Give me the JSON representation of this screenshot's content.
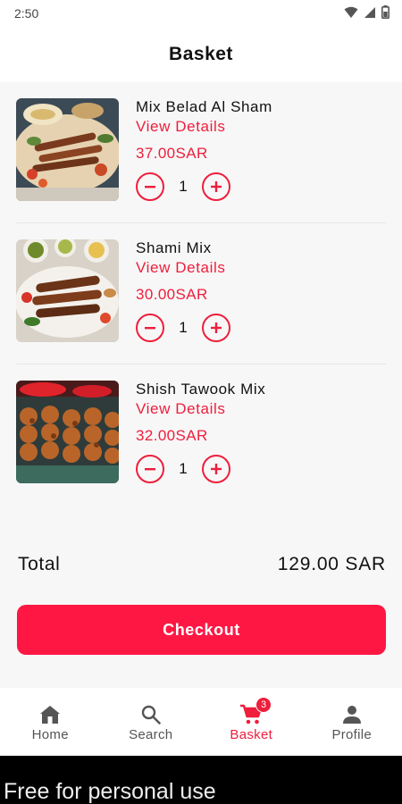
{
  "status_bar": {
    "time": "2:50"
  },
  "header": {
    "title": "Basket"
  },
  "items": [
    {
      "name": "Mix Belad Al Sham",
      "details": "View Details",
      "price": "37.00SAR",
      "qty": "1"
    },
    {
      "name": "Shami Mix",
      "details": "View Details",
      "price": "30.00SAR",
      "qty": "1"
    },
    {
      "name": "Shish Tawook Mix",
      "details": "View Details",
      "price": "32.00SAR",
      "qty": "1"
    }
  ],
  "summary": {
    "total_label": "Total",
    "total_value": "129.00 SAR"
  },
  "checkout": {
    "label": "Checkout"
  },
  "nav": {
    "home": "Home",
    "search": "Search",
    "basket": "Basket",
    "basket_badge": "3",
    "profile": "Profile"
  },
  "watermark": "Free for personal use",
  "colors": {
    "accent": "#ee1e3c",
    "checkout": "#ff1744"
  },
  "icons": [
    "wifi-icon",
    "signal-icon",
    "battery-icon",
    "minus-icon",
    "plus-icon",
    "home-icon",
    "search-icon",
    "cart-icon",
    "person-icon"
  ]
}
